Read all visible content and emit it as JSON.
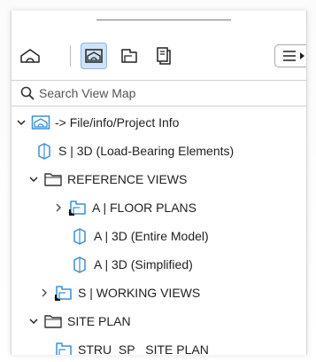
{
  "toolbar": {
    "buttons": [
      {
        "icon": "project-map-icon",
        "active": false
      },
      {
        "icon": "view-map-icon",
        "active": true
      },
      {
        "icon": "layout-book-icon",
        "active": false
      },
      {
        "icon": "publisher-sets-icon",
        "active": false
      }
    ],
    "menu_icon": "hamburger-menu-icon"
  },
  "search": {
    "placeholder": "Search View Map"
  },
  "tree": {
    "root": {
      "label": "-> File/info/Project Info",
      "expanded": true
    },
    "items": [
      {
        "label": "S | 3D (Load-Bearing Elements)"
      },
      {
        "label": "REFERENCE VIEWS",
        "expanded": true
      },
      {
        "label": "A | FLOOR PLANS",
        "expanded": false
      },
      {
        "label": "A | 3D (Entire Model)"
      },
      {
        "label": "A | 3D (Simplified)"
      },
      {
        "label": "S | WORKING VIEWS",
        "expanded": false
      },
      {
        "label": "SITE PLAN",
        "expanded": true
      },
      {
        "label": "STRU_SP_ SITE PLAN"
      }
    ]
  },
  "colors": {
    "accent": "#3b8ed6",
    "active_bg": "#cfe3f7",
    "icon_stroke": "#222222"
  }
}
